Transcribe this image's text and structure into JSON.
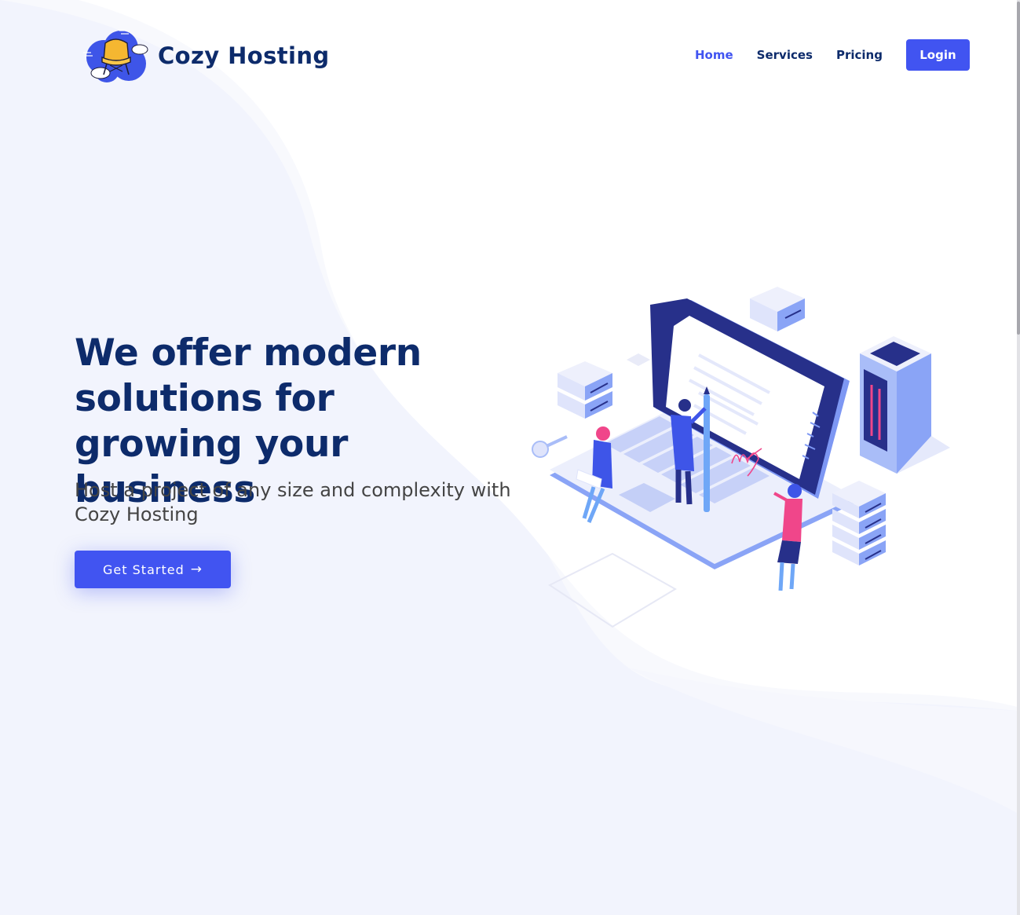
{
  "brand": {
    "name": "Cozy Hosting",
    "logo_icon": "armchair-cloud-logo"
  },
  "nav": {
    "items": [
      {
        "label": "Home",
        "active": true
      },
      {
        "label": "Services",
        "active": false
      },
      {
        "label": "Pricing",
        "active": false
      }
    ],
    "login_label": "Login"
  },
  "hero": {
    "title": "We offer modern solutions for growing your business",
    "subtitle": "Host a project of any size and complexity with Cozy Hosting",
    "cta_label": "Get Started",
    "cta_icon": "arrow-right-icon",
    "illustration": "isometric-laptop-servers-people"
  },
  "colors": {
    "accent": "#4154f1",
    "heading": "#0d2b6b",
    "text": "#444444",
    "background": "#f2f4fd",
    "highlight_pink": "#f0468a"
  }
}
